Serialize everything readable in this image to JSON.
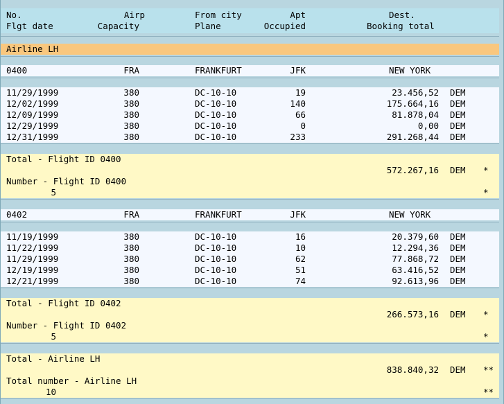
{
  "headers": {
    "row1": [
      "No.",
      "Airp",
      "From city",
      "Apt",
      "Dest."
    ],
    "row2": [
      "Flgt date",
      "Capacity",
      "Plane",
      "Occupied",
      "Booking total"
    ]
  },
  "airline_label": "Airline LH",
  "groups": [
    {
      "summary": [
        "0400",
        "FRA",
        "FRANKFURT",
        "JFK",
        "NEW YORK"
      ],
      "flights": [
        [
          "11/29/1999",
          "380",
          "DC-10-10",
          "19",
          "23.456,52",
          "DEM"
        ],
        [
          "12/02/1999",
          "380",
          "DC-10-10",
          "140",
          "175.664,16",
          "DEM"
        ],
        [
          "12/09/1999",
          "380",
          "DC-10-10",
          "66",
          "81.878,04",
          "DEM"
        ],
        [
          "12/29/1999",
          "380",
          "DC-10-10",
          "0",
          "0,00",
          "DEM"
        ],
        [
          "12/31/1999",
          "380",
          "DC-10-10",
          "233",
          "291.268,44",
          "DEM"
        ]
      ],
      "total_label": "Total - Flight ID 0400",
      "total_value": "572.267,16",
      "total_currency": "DEM",
      "total_mark": "*",
      "number_label": "Number - Flight ID 0400",
      "number_value": "5",
      "number_mark": "*"
    },
    {
      "summary": [
        "0402",
        "FRA",
        "FRANKFURT",
        "JFK",
        "NEW YORK"
      ],
      "flights": [
        [
          "11/19/1999",
          "380",
          "DC-10-10",
          "16",
          "20.379,60",
          "DEM"
        ],
        [
          "11/22/1999",
          "380",
          "DC-10-10",
          "10",
          "12.294,36",
          "DEM"
        ],
        [
          "11/29/1999",
          "380",
          "DC-10-10",
          "62",
          "77.868,72",
          "DEM"
        ],
        [
          "12/19/1999",
          "380",
          "DC-10-10",
          "51",
          "63.416,52",
          "DEM"
        ],
        [
          "12/21/1999",
          "380",
          "DC-10-10",
          "74",
          "92.613,96",
          "DEM"
        ]
      ],
      "total_label": "Total - Flight ID 0402",
      "total_value": "266.573,16",
      "total_currency": "DEM",
      "total_mark": "*",
      "number_label": "Number - Flight ID 0402",
      "number_value": "5",
      "number_mark": "*"
    }
  ],
  "grand": {
    "total_label": "Total - Airline LH",
    "total_value": "838.840,32",
    "total_currency": "DEM",
    "total_mark": "**",
    "number_label": "Total number - Airline LH",
    "number_value": "10",
    "number_mark": "**"
  }
}
